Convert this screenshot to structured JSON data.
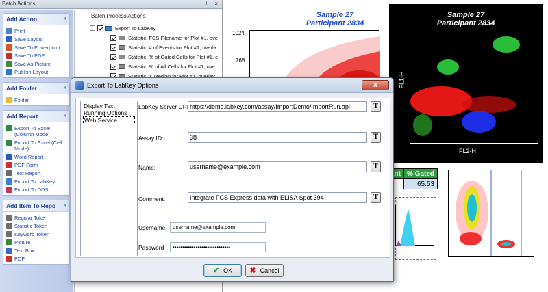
{
  "batch_pane": {
    "title": "Batch Actions",
    "title_buttons": "⊥ ×",
    "groups": [
      {
        "title": "Add Action",
        "items": [
          {
            "label": "Print",
            "icon": "printer-icon",
            "color": "#4a7fd4"
          },
          {
            "label": "Save Layout",
            "icon": "save-icon",
            "color": "#2a62c6"
          },
          {
            "label": "Save To Powerpoint",
            "icon": "powerpoint-icon",
            "color": "#d9552a"
          },
          {
            "label": "Save To PDF",
            "icon": "pdf-icon",
            "color": "#c8302a"
          },
          {
            "label": "Save As Picture",
            "icon": "picture-icon",
            "color": "#3a8a3a"
          },
          {
            "label": "Publish Layout",
            "icon": "globe-icon",
            "color": "#2a78c6"
          }
        ]
      },
      {
        "title": "Add Folder",
        "items": [
          {
            "label": "Folder",
            "icon": "folder-icon",
            "color": "#e8b830"
          }
        ]
      },
      {
        "title": "Add Report",
        "items": [
          {
            "label": "Export To Excel (Column Mode)",
            "icon": "excel-icon",
            "color": "#2f8a3f"
          },
          {
            "label": "Export To Excel (Cell Mode)",
            "icon": "excel-icon",
            "color": "#2f8a3f"
          },
          {
            "label": "Word Report",
            "icon": "word-icon",
            "color": "#2a5ab8"
          },
          {
            "label": "PDF Form",
            "icon": "pdf-icon",
            "color": "#c8302a"
          },
          {
            "label": "Text Report",
            "icon": "text-icon",
            "color": "#6a6a6a"
          },
          {
            "label": "Export To LabKey",
            "icon": "labkey-icon",
            "color": "#3a7fd0"
          },
          {
            "label": "Export To DDS",
            "icon": "dds-icon",
            "color": "#c83060"
          }
        ]
      },
      {
        "title": "Add Item To Repo",
        "items": [
          {
            "label": "Regular Token",
            "icon": "token-icon",
            "color": "#707070"
          },
          {
            "label": "Statistic Token",
            "icon": "token-icon",
            "color": "#707070"
          },
          {
            "label": "Keyword Token",
            "icon": "token-icon",
            "color": "#707070"
          },
          {
            "label": "Picture",
            "icon": "picture-icon",
            "color": "#3a8a3a"
          },
          {
            "label": "Text Box",
            "icon": "textbox-icon",
            "color": "#3a6ad0"
          },
          {
            "label": "PDF",
            "icon": "pdf-icon",
            "color": "#c8302a"
          }
        ]
      }
    ],
    "tree_header": "Batch Process Actions",
    "tree_root": "Export To LabKey",
    "tree_items": [
      "Statistic: FCS Filename for Plot #1, ove",
      "Statistic: # of Events for Plot #1, overla",
      "Statistic: % of Gated Cells for Plot #1, c",
      "Statistic: % of All Cells for Plot #1, ove",
      "Statistic: X Median for Plot #1, overlay"
    ]
  },
  "canvas": {
    "plot1": {
      "title_line1": "Sample 27",
      "title_line2": "Participant 2834",
      "yticks": [
        "1024",
        "768"
      ]
    },
    "plot2": {
      "title_line1": "Sample 27",
      "title_line2": "Participant 2834",
      "xlabel": "FL2-H",
      "ylabel": "FL1-H"
    },
    "stats": {
      "header_left": "ant",
      "header_right": "% Gated",
      "value": "65.53"
    }
  },
  "dialog": {
    "title": "Export To LabKey Options",
    "close_label": "x",
    "nav": [
      "Display Text",
      "Running Options",
      "Web Service"
    ],
    "nav_selected": "Web Service",
    "fields": {
      "server_label": "LabKey Server URL:",
      "server_value": "https://demo.labkey.com/assay/ImportDemo/ImportRun.api",
      "assay_label": "Assay ID:",
      "assay_value": "38",
      "name_label": "Name:",
      "name_value": "username@example.com",
      "comment_label": "Comment:",
      "comment_value": "Integrate FCS Express data with ELISA Spot 394",
      "username_label": "Username",
      "username_value": "username@example.com",
      "password_label": "Password",
      "password_value": "••••••••••••••••••••••••••••••"
    },
    "token_button_label": "T",
    "ok_label": "OK",
    "cancel_label": "Cancel"
  }
}
